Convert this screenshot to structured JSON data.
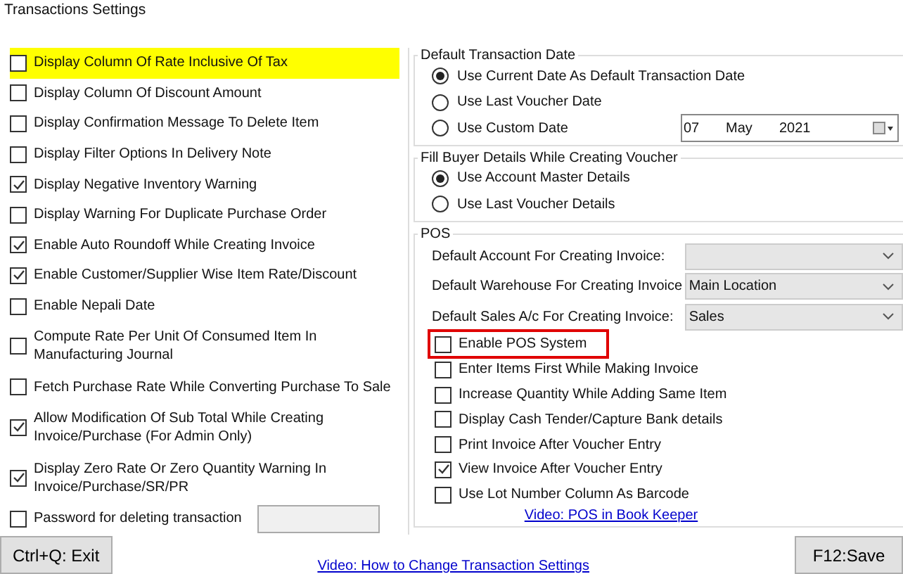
{
  "window": {
    "title": "Transactions Settings"
  },
  "options": [
    {
      "label": "Display Column Of Rate Inclusive Of Tax",
      "checked": false,
      "highlighted": true
    },
    {
      "label": "Display Column Of Discount Amount",
      "checked": false,
      "highlighted": false
    },
    {
      "label": "Display Confirmation Message To Delete Item",
      "checked": false,
      "highlighted": false
    },
    {
      "label": "Display Filter Options In Delivery Note",
      "checked": false,
      "highlighted": false
    },
    {
      "label": "Display Negative Inventory Warning",
      "checked": true,
      "highlighted": false
    },
    {
      "label": "Display Warning For Duplicate Purchase Order",
      "checked": false,
      "highlighted": false
    },
    {
      "label": "Enable Auto Roundoff While Creating Invoice",
      "checked": true,
      "highlighted": false
    },
    {
      "label": "Enable Customer/Supplier Wise Item Rate/Discount",
      "checked": true,
      "highlighted": false
    },
    {
      "label": "Enable Nepali Date",
      "checked": false,
      "highlighted": false
    },
    {
      "label": "Compute Rate Per Unit Of Consumed Item In Manufacturing Journal",
      "checked": false,
      "highlighted": false
    },
    {
      "label": "Fetch Purchase Rate While Converting Purchase To Sale",
      "checked": false,
      "highlighted": false
    },
    {
      "label": "Allow Modification Of Sub Total  While Creating Invoice/Purchase (For Admin Only)",
      "checked": true,
      "highlighted": false
    },
    {
      "label": "Display Zero Rate Or Zero Quantity Warning In Invoice/Purchase/SR/PR",
      "checked": true,
      "highlighted": false
    }
  ],
  "password": {
    "label": "Password for deleting transaction",
    "checked": false
  },
  "default_transaction_date": {
    "title": "Default Transaction Date",
    "options": [
      {
        "label": "Use Current Date As Default Transaction Date",
        "selected": true
      },
      {
        "label": "Use Last Voucher Date",
        "selected": false
      },
      {
        "label": "Use Custom Date",
        "selected": false
      }
    ],
    "date": {
      "day": "07",
      "month": "May",
      "year": "2021"
    }
  },
  "fill_buyer_details": {
    "title": "Fill Buyer Details While Creating Voucher",
    "options": [
      {
        "label": "Use Account Master Details",
        "selected": true
      },
      {
        "label": "Use Last Voucher Details",
        "selected": false
      }
    ]
  },
  "pos": {
    "title": "POS",
    "dropdowns": [
      {
        "label": "Default Account For Creating Invoice:"
      },
      {
        "label": "Default Warehouse For Creating Invoice",
        "value": "Main Location"
      },
      {
        "label": "Default Sales A/c For Creating Invoice:",
        "value": "Sales"
      }
    ],
    "options": [
      {
        "label": "Enable POS System",
        "checked": false,
        "highlighted": true
      },
      {
        "label": "Enter Items First While Making Invoice",
        "checked": false,
        "highlighted": false
      },
      {
        "label": "Increase Quantity While Adding Same Item",
        "checked": false,
        "highlighted": false
      },
      {
        "label": "Display Cash Tender/Capture Bank details",
        "checked": false,
        "highlighted": false
      },
      {
        "label": "Print Invoice After Voucher Entry",
        "checked": false,
        "highlighted": false
      },
      {
        "label": "View Invoice After Voucher Entry",
        "checked": true,
        "highlighted": false
      },
      {
        "label": "Use Lot Number Column As Barcode",
        "checked": false,
        "highlighted": false
      }
    ],
    "link": "Video: POS in Book Keeper"
  },
  "footer": {
    "exit": "Ctrl+Q: Exit",
    "link": "Video: How to Change Transaction Settings",
    "save": "F12:Save"
  }
}
